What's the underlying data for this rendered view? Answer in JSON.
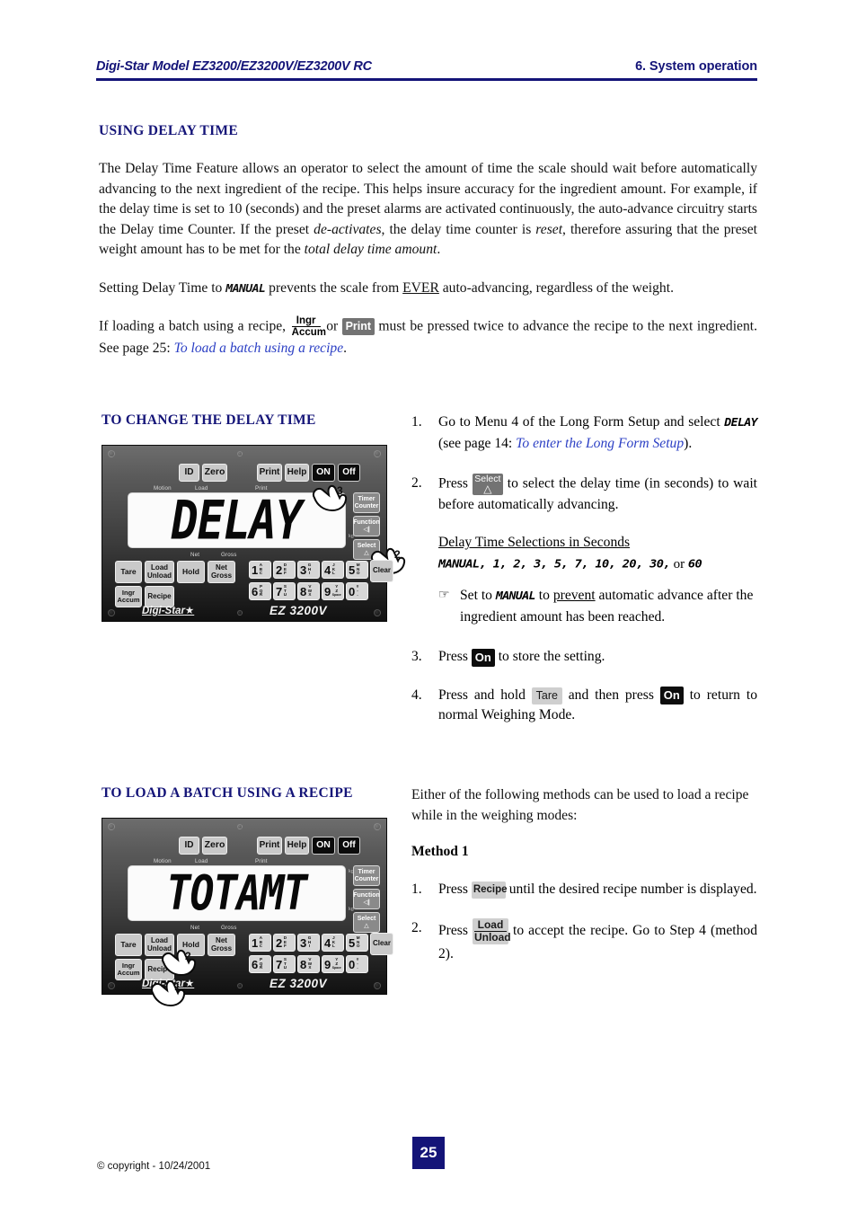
{
  "header": {
    "left": "Digi-Star Model EZ3200/EZ3200V/EZ3200V RC",
    "right": "6. System operation"
  },
  "footer": {
    "copyright": "© copyright - 10/24/2001",
    "page_number": "25"
  },
  "colors": {
    "heading_blue": "#141478",
    "link_blue": "#2b3fc4",
    "page_box": "#141478"
  },
  "section1": {
    "heading": "USING DELAY TIME",
    "p1_a": "The Delay Time Feature allows an operator to select the amount of time the scale should wait before automatically advancing to the next ingredient of the recipe.  This helps insure accuracy for the ingredient amount. For example, if the delay time is set to 10 (seconds) and the preset alarms are activated continuously, the auto-advance circuitry starts the Delay time Counter. If the preset ",
    "p1_it1": "de-activates",
    "p1_b": ", the delay time counter is ",
    "p1_it2": "reset",
    "p1_c": ", therefore assuring that the preset weight amount has to be met for the ",
    "p1_it3": "total delay time amount",
    "p1_d": ".",
    "p2_a": "Setting Delay Time to ",
    "p2_lcd": "MANUAL",
    "p2_b": " prevents the scale from ",
    "p2_ul": "EVER",
    "p2_c": " auto-advancing, regardless of the weight.",
    "p3_a": "If loading a batch using a recipe, ",
    "p3_b": " or ",
    "p3_c": " must be pressed twice to advance the recipe to the next ingredient.  See page 25: ",
    "p3_link": "To load a batch using a recipe",
    "p3_d": "."
  },
  "section2": {
    "heading": "TO CHANGE THE DELAY TIME",
    "steps": [
      {
        "num": "1.",
        "a": "Go to Menu 4 of the Long Form Setup and select ",
        "lcd": "DELAY",
        "b": " (see page 14: ",
        "link": "To enter the Long Form Setup",
        "c": ")."
      },
      {
        "num": "2.",
        "a": "Press ",
        "b": " to select the delay time (in seconds) to wait before automatically advancing."
      },
      {
        "num": "3.",
        "a": "Press ",
        "b": " to store the setting."
      },
      {
        "num": "4.",
        "a": "Press and hold ",
        "b": " and then press ",
        "c": " to return to normal Weighing Mode."
      }
    ],
    "selections_title": "Delay Time Selections in Seconds",
    "selections_lcd1": "MANUAL, 1, 2, 3, 5, 7, 10, 20, 30,",
    "selections_or": "or",
    "selections_lcd2": "60",
    "note_pointer": "☞",
    "note_a": "Set to ",
    "note_lcd": "MANUAL",
    "note_b": " to ",
    "note_ul": "prevent",
    "note_c": " automatic advance after the ingredient amount has been reached."
  },
  "section3": {
    "heading": "TO LOAD A BATCH USING A RECIPE",
    "intro": "Either of the following methods can be used to load a recipe while in the weighing modes:",
    "method_title": "Method 1",
    "steps": [
      {
        "num": "1.",
        "a": "Press ",
        "b": " until the desired recipe number is displayed."
      },
      {
        "num": "2.",
        "a": "Press ",
        "b": " to accept the recipe. Go to Step 4 (method 2)."
      }
    ]
  },
  "keycaps": {
    "ingr_top": "Ingr",
    "ingr_bottom": "Accum",
    "print": "Print",
    "select": "Select",
    "select_arrow": "△",
    "on": "On",
    "tare": "Tare",
    "recipe": "Recipe",
    "load": "Load",
    "unload": "Unload"
  },
  "scale1": {
    "display": "DELAY",
    "model": "EZ 3200V",
    "brand": "Digi-Star",
    "brand_star": "★",
    "top_buttons": [
      {
        "label": "ID",
        "style": "light"
      },
      {
        "label": "Zero",
        "style": "light"
      },
      {
        "label": "Print",
        "style": "light"
      },
      {
        "label": "Help",
        "style": "light"
      },
      {
        "label": "ON",
        "style": "dark"
      },
      {
        "label": "Off",
        "style": "dark"
      }
    ],
    "annotations_top": [
      "Motion",
      "Load",
      "Print"
    ],
    "annotations_bottom": [
      "Net",
      "Gross"
    ],
    "unit": "kg",
    "side_buttons": [
      {
        "line1": "Timer",
        "line2": "Counter"
      },
      {
        "line1": "Function",
        "line2": "◁|"
      },
      {
        "line1": "Select",
        "line2": "△"
      }
    ],
    "left_buttons": [
      {
        "line1": "Tare",
        "line2": ""
      },
      {
        "line1": "Load",
        "line2": "Unload"
      },
      {
        "line1": "Hold",
        "line2": ""
      },
      {
        "line1": "Net",
        "line2": "Gross"
      },
      {
        "line1": "Ingr",
        "line2": "Accum"
      },
      {
        "line1": "Recipe",
        "line2": ""
      }
    ],
    "clear_label": "Clear",
    "keypad": [
      {
        "digit": "1",
        "letters": "ABC"
      },
      {
        "digit": "2",
        "letters": "DEF"
      },
      {
        "digit": "3",
        "letters": "GHI"
      },
      {
        "digit": "4",
        "letters": "JKL"
      },
      {
        "digit": "5",
        "letters": "MNO"
      },
      {
        "digit": "6",
        "letters": "PQR"
      },
      {
        "digit": "7",
        "letters": "STU"
      },
      {
        "digit": "8",
        "letters": "VWX"
      },
      {
        "digit": "9",
        "letters": "YZ",
        "sub": "Space"
      },
      {
        "digit": "0",
        "letters": "#-."
      }
    ],
    "hand_labels": [
      "3",
      "2"
    ]
  },
  "scale2": {
    "display": "TOTAMT",
    "model": "EZ 3200V",
    "brand": "Digi-Star",
    "brand_star": "★",
    "hand_labels": [
      "1",
      "2"
    ]
  }
}
